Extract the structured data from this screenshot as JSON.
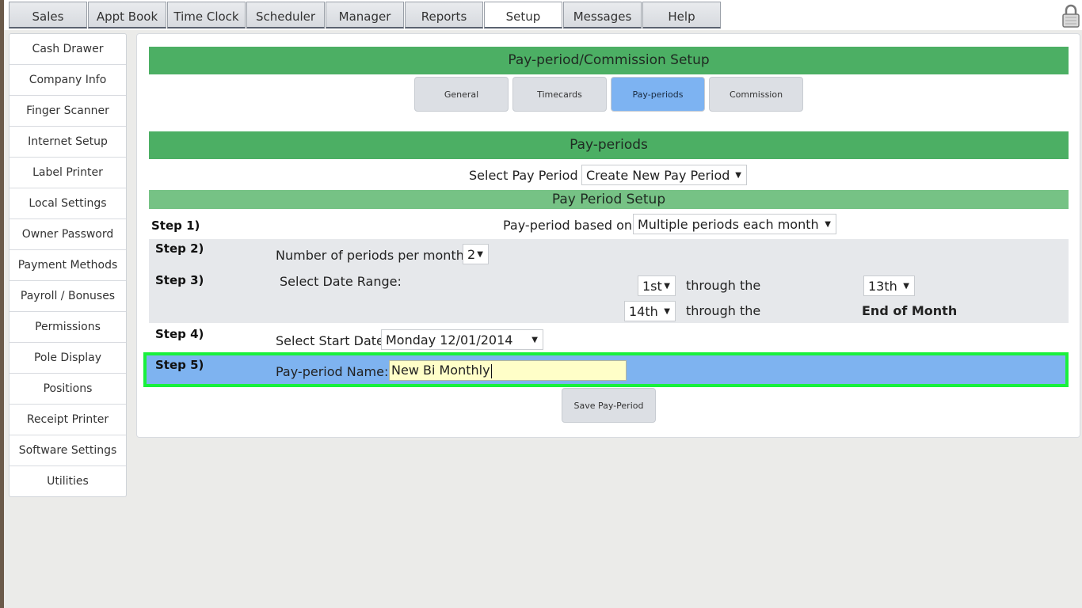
{
  "top_tabs": [
    "Sales",
    "Appt Book",
    "Time Clock",
    "Scheduler",
    "Manager",
    "Reports",
    "Setup",
    "Messages",
    "Help"
  ],
  "active_top_tab": "Setup",
  "sidebar": {
    "items": [
      {
        "label": "Cash Drawer"
      },
      {
        "label": "Company Info"
      },
      {
        "label": "Finger Scanner"
      },
      {
        "label": "Internet Setup"
      },
      {
        "label": "Label Printer"
      },
      {
        "label": "Local Settings"
      },
      {
        "label": "Owner Password"
      },
      {
        "label": "Payment Methods"
      },
      {
        "label": "Payroll / Bonuses"
      },
      {
        "label": "Permissions"
      },
      {
        "label": "Pole Display"
      },
      {
        "label": "Positions"
      },
      {
        "label": "Receipt Printer"
      },
      {
        "label": "Software Settings"
      },
      {
        "label": "Utilities"
      }
    ]
  },
  "main": {
    "title": "Pay-period/Commission Setup",
    "subtabs": [
      {
        "label": "General"
      },
      {
        "label": "Timecards"
      },
      {
        "label": "Pay-periods"
      },
      {
        "label": "Commission"
      }
    ],
    "active_subtab": "Pay-periods",
    "section_title": "Pay-periods",
    "select_pay_period": {
      "label": "Select Pay Period :",
      "value": "Create New Pay Period"
    },
    "setup_title": "Pay Period Setup",
    "step1": {
      "step": "Step 1)",
      "label": "Pay-period based on:",
      "value": "Multiple periods each month"
    },
    "step2": {
      "step": "Step 2)",
      "label": "Number of periods per month:",
      "value": "2"
    },
    "step3": {
      "step": "Step 3)",
      "label": "Select Date Range:",
      "range1": {
        "from": "1st",
        "through": "through the",
        "to": "13th"
      },
      "range2": {
        "from": "14th",
        "through": "through the",
        "to": "End of Month"
      }
    },
    "step4": {
      "step": "Step 4)",
      "label": "Select Start Date:",
      "value": "Monday 12/01/2014"
    },
    "step5": {
      "step": "Step 5)",
      "label": "Pay-period Name:",
      "value": "New Bi Monthly"
    },
    "save_label": "Save Pay-Period"
  },
  "colors": {
    "green_header": "#4caf64",
    "light_green": "#76c285",
    "active_blue": "#7db3f2",
    "highlight_border": "#19f03c",
    "input_yellow": "#fffec8"
  }
}
